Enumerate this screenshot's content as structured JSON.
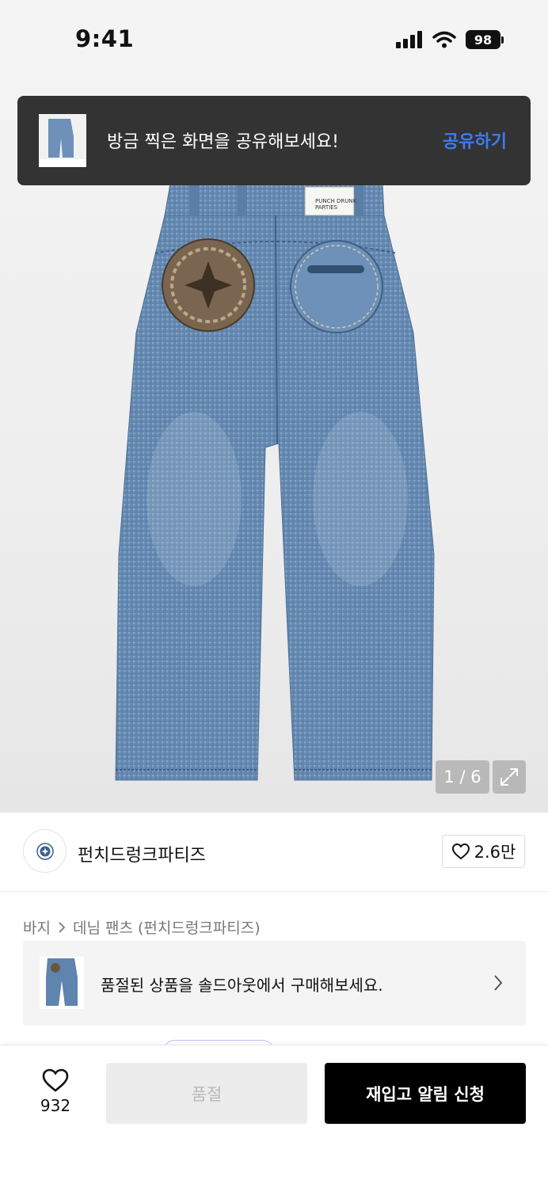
{
  "status_bar": {
    "time": "9:41",
    "battery": "98",
    "icons": [
      "signal-icon",
      "wifi-icon",
      "battery-icon"
    ]
  },
  "toast": {
    "message": "방금 찍은 화면을 공유해보세요!",
    "action_label": "공유하기",
    "action_color": "#3b7cf6"
  },
  "gallery": {
    "counter": "1 / 6",
    "current_index": 1,
    "total": 6,
    "patch_text": "PUNCH DRUNK PARTIES",
    "tag_text": "PUNCH DRUNK PARTIES"
  },
  "brand": {
    "name": "펀치드렁크파티즈",
    "like_count": "2.6만"
  },
  "breadcrumb": {
    "category": "바지",
    "subcategory": "데님 팬츠 (펀치드렁크파티즈)"
  },
  "soldout_banner": {
    "text": "품절된 상품을 솔드아웃에서 구매해보세요."
  },
  "bottom_bar": {
    "wish_count": "932",
    "soldout_label": "품절",
    "restock_label": "재입고 알림 신청"
  },
  "colors": {
    "toast_bg": "#333333",
    "primary_button": "#000000",
    "disabled_button": "#ececec",
    "denim": "#6c8fb5"
  }
}
